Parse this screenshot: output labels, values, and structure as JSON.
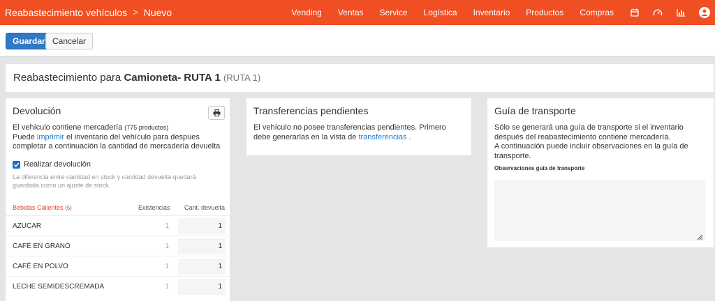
{
  "header": {
    "breadcrumb": [
      "Reabastecimiento vehículos",
      "Nuevo"
    ],
    "breadcrumb_separator": ">",
    "nav": [
      "Vending",
      "Ventas",
      "Service",
      "Logística",
      "Inventario",
      "Productos",
      "Compras"
    ],
    "icons": [
      "calendar-icon",
      "speedometer-icon",
      "bar-chart-icon",
      "user-avatar-icon"
    ],
    "accent_color": "#f04e23"
  },
  "toolbar": {
    "save_label": "Guardar",
    "cancel_label": "Cancelar"
  },
  "title": {
    "prefix": "Reabastecimiento para",
    "vehicle": "Camioneta- RUTA 1",
    "code": "(RUTA 1)"
  },
  "devolucion": {
    "heading": "Devolución",
    "line1_prefix": "El vehículo contiene mercadería",
    "product_count": "(775 productos)",
    "line2_prefix": "Puede",
    "line2_link": "imprimir",
    "line2_suffix": "el inventario del vehículo para despues completar a continuación la cantidad de mercadería devuelta",
    "checkbox_label": "Realizar devolución",
    "checkbox_checked": true,
    "hint": "La diferencia entre cantidad en stock y cantidad devuelta quedará guardada como un ajuste de stock.",
    "table": {
      "category": "Bebidas Calientes",
      "category_count": "(5)",
      "col_stock": "Existencias",
      "col_returned": "Cant. devuelta",
      "rows": [
        {
          "name": "AZUCAR",
          "stock": "1",
          "returned": "1"
        },
        {
          "name": "CAFÉ EN GRANO",
          "stock": "1",
          "returned": "1"
        },
        {
          "name": "CAFÉ EN POLVO",
          "stock": "1",
          "returned": "1"
        },
        {
          "name": "LECHE SEMIDESCREMADA",
          "stock": "1",
          "returned": "1"
        }
      ]
    }
  },
  "transferencias": {
    "heading": "Transferencias pendientes",
    "text": "El vehículo no posee transferencias pendientes. Primero debe generarlas en la vista de",
    "link": "transferencias",
    "suffix": "."
  },
  "guia": {
    "heading": "Guía de transporte",
    "text1": "Sólo se generará una guía de transporte si el inventario después del reabastecimiento contiene mercadería.",
    "text2": "A continuación puede incluir observaciones en la guía de transporte.",
    "obs_label": "Observaciones guía de transporte",
    "obs_value": ""
  }
}
